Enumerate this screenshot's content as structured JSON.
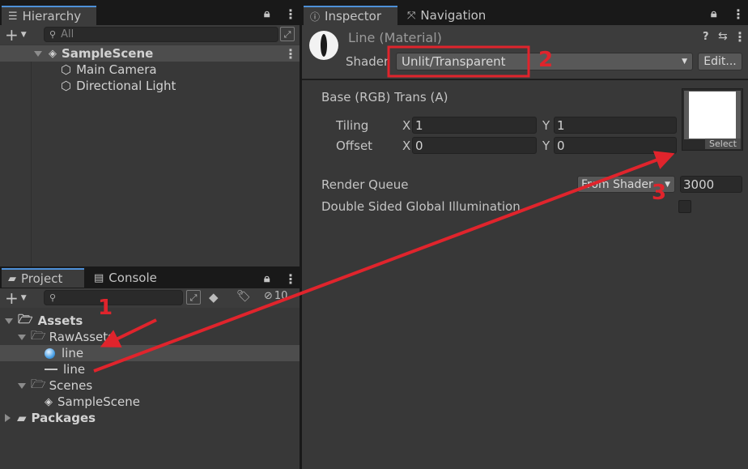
{
  "hierarchy": {
    "tab_label": "Hierarchy",
    "search_placeholder": "All",
    "scene_name": "SampleScene",
    "items": [
      {
        "label": "Main Camera",
        "icon": "cube-icon"
      },
      {
        "label": "Directional Light",
        "icon": "cube-icon"
      }
    ]
  },
  "project": {
    "tab_label": "Project",
    "console_tab_label": "Console",
    "hidden_count": "10",
    "tree": {
      "assets": "Assets",
      "raw_assets": "RawAssets",
      "line_material": "line",
      "line_object": "line",
      "scenes": "Scenes",
      "sample_scene": "SampleScene",
      "packages": "Packages"
    }
  },
  "inspector": {
    "tab_label": "Inspector",
    "navigation_tab_label": "Navigation",
    "material_title": "Line (Material)",
    "shader_label": "Shader",
    "shader_value": "Unlit/Transparent",
    "edit_button": "Edit...",
    "base_label": "Base (RGB) Trans (A)",
    "tiling_label": "Tiling",
    "offset_label": "Offset",
    "x_label": "X",
    "y_label": "Y",
    "tiling_x": "1",
    "tiling_y": "1",
    "offset_x": "0",
    "offset_y": "0",
    "select_label": "Select",
    "render_queue_label": "Render Queue",
    "render_queue_mode": "From Shader",
    "render_queue_value": "3000",
    "double_sided_label": "Double Sided Global Illumination"
  },
  "annotations": {
    "marker_1": "1",
    "marker_2": "2",
    "marker_3": "3",
    "color": "#e0242c"
  },
  "colors": {
    "panel_bg": "#383838",
    "tab_accent": "#4d90d8",
    "selection_bg": "#4d4d4d"
  }
}
